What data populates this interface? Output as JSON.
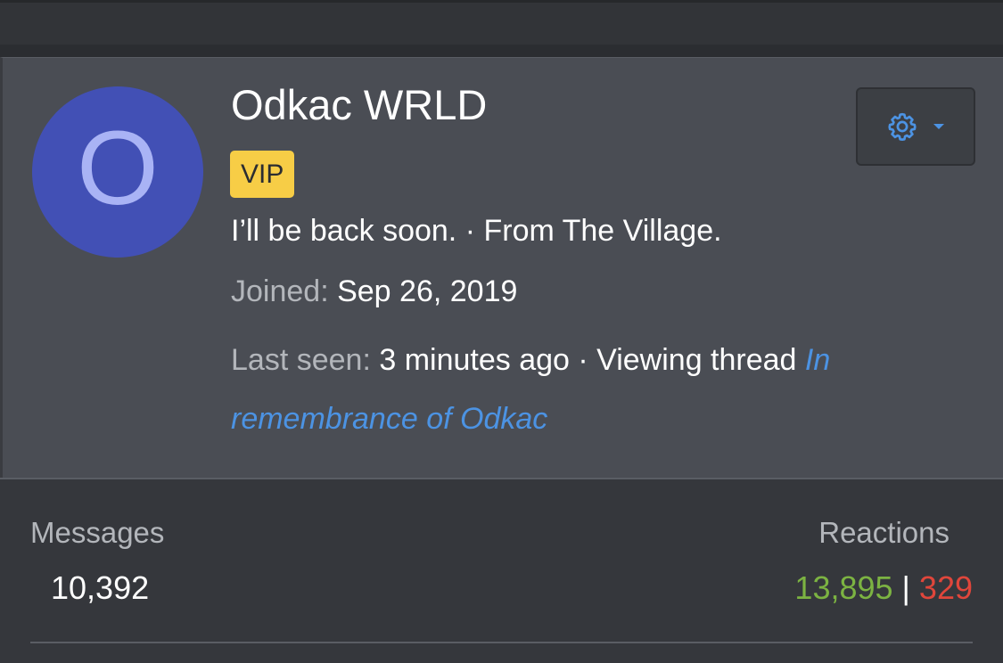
{
  "profile": {
    "avatar_letter": "O",
    "username": "Odkac WRLD",
    "badge": "VIP",
    "status_text": "I’ll be back soon. · From The Village.",
    "joined_label": "Joined:",
    "joined_value": "Sep 26, 2019",
    "last_seen_label": "Last seen:",
    "last_seen_value": "3 minutes ago",
    "activity_prefix": "· Viewing thread",
    "thread_title": "In remembrance of Odkac"
  },
  "settings": {
    "icon": "gear-icon",
    "caret_icon": "caret-down-icon"
  },
  "stats": {
    "messages_label": "Messages",
    "messages_value": "10,392",
    "reactions_label": "Reactions",
    "reactions_positive": "13,895",
    "reactions_separator": "|",
    "reactions_negative": "329"
  },
  "colors": {
    "avatar_bg": "#4250b5",
    "badge_bg": "#f7cd46",
    "link": "#4c93e3",
    "positive": "#7cb342",
    "negative": "#e0463b",
    "card_bg": "#4a4d54",
    "panel_bg": "#35373c"
  }
}
